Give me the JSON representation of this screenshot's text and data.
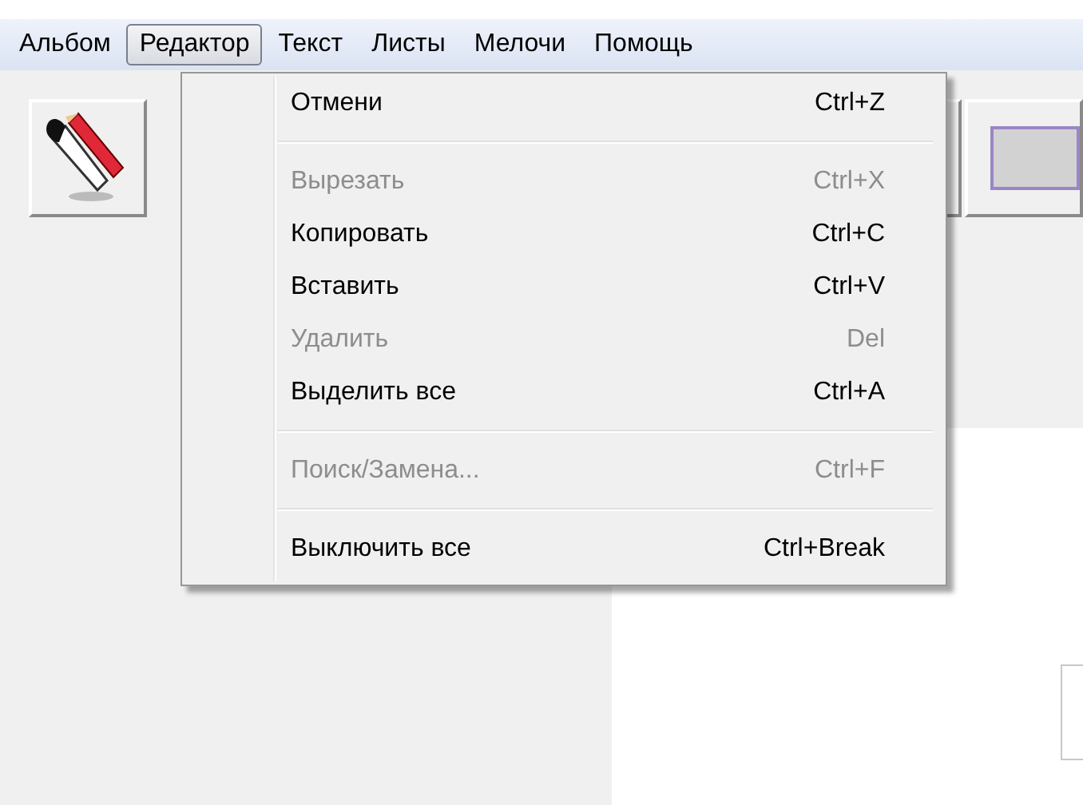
{
  "menubar": [
    {
      "label": "Альбом",
      "selected": false
    },
    {
      "label": "Редактор",
      "selected": true
    },
    {
      "label": "Текст",
      "selected": false
    },
    {
      "label": "Листы",
      "selected": false
    },
    {
      "label": "Мелочи",
      "selected": false
    },
    {
      "label": "Помощь",
      "selected": false
    }
  ],
  "menu": [
    {
      "kind": "item",
      "label": "Отмени",
      "shortcut": "Ctrl+Z",
      "disabled": false
    },
    {
      "kind": "separator"
    },
    {
      "kind": "item",
      "label": "Вырезать",
      "shortcut": "Ctrl+X",
      "disabled": true
    },
    {
      "kind": "item",
      "label": "Копировать",
      "shortcut": "Ctrl+C",
      "disabled": false
    },
    {
      "kind": "item",
      "label": "Вставить",
      "shortcut": "Ctrl+V",
      "disabled": false
    },
    {
      "kind": "item",
      "label": "Удалить",
      "shortcut": "Del",
      "disabled": true
    },
    {
      "kind": "item",
      "label": "Выделить все",
      "shortcut": "Ctrl+A",
      "disabled": false
    },
    {
      "kind": "separator"
    },
    {
      "kind": "item",
      "label": "Поиск/Замена...",
      "shortcut": "Ctrl+F",
      "disabled": true
    },
    {
      "kind": "separator"
    },
    {
      "kind": "item",
      "label": "Выключить все",
      "shortcut": "Ctrl+Break",
      "disabled": false
    }
  ]
}
